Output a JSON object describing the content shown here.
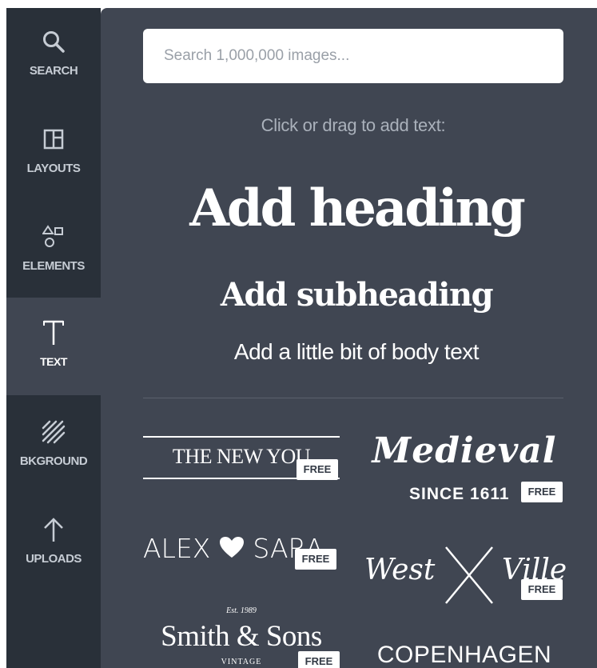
{
  "sidebar": {
    "items": [
      {
        "label": "SEARCH",
        "icon": "search-icon"
      },
      {
        "label": "LAYOUTS",
        "icon": "layouts-icon"
      },
      {
        "label": "ELEMENTS",
        "icon": "elements-icon"
      },
      {
        "label": "TEXT",
        "icon": "text-icon",
        "active": true
      },
      {
        "label": "BKGROUND",
        "icon": "background-icon"
      },
      {
        "label": "UPLOADS",
        "icon": "upload-arrow-icon"
      }
    ]
  },
  "panel": {
    "search_placeholder": "Search 1,000,000 images...",
    "hint": "Click or drag to add text:",
    "heading": "Add heading",
    "subheading": "Add subheading",
    "body": "Add a little bit of body text"
  },
  "templates": {
    "free_badge": "FREE",
    "new_you": "THE NEW YOU",
    "medieval": "Medieval",
    "medieval_since": "SINCE 1611",
    "alex_left": "ALEX",
    "alex_right": "SARA",
    "west": "West",
    "ville": "Ville",
    "est": "Est. 1989",
    "smith": "Smith & Sons",
    "vintage": "VINTAGE",
    "copenhagen": "COPENHAGEN"
  },
  "colors": {
    "sidebar_bg": "#293039",
    "panel_bg": "#404652",
    "hint_text": "#aab1bb",
    "nav_text": "#c6ccd4"
  }
}
